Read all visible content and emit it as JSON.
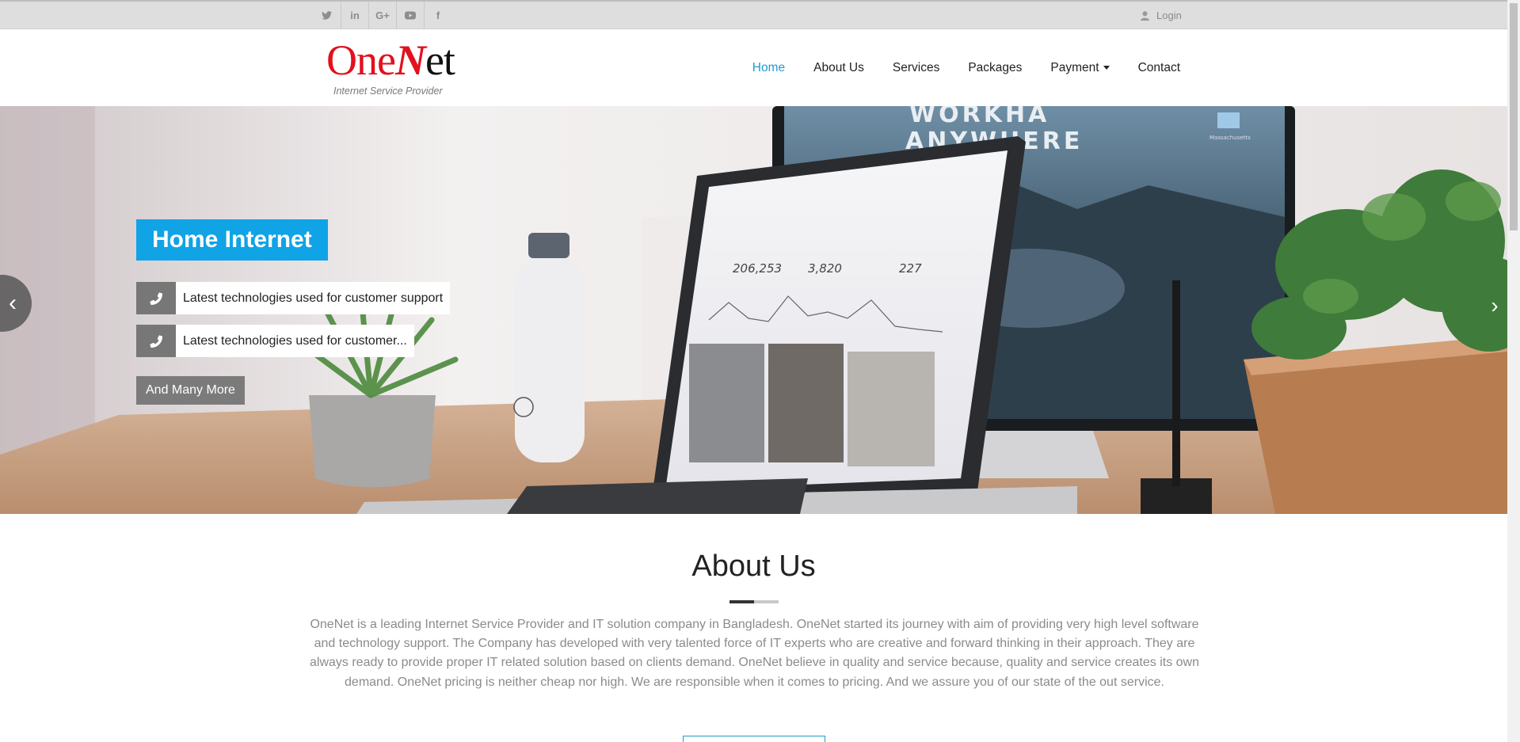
{
  "topbar": {
    "social": [
      {
        "icon": "twitter-icon",
        "glyph": "🐦"
      },
      {
        "icon": "linkedin-icon",
        "glyph": "in"
      },
      {
        "icon": "google-plus-icon",
        "glyph": "G+"
      },
      {
        "icon": "youtube-icon",
        "glyph": "▶"
      },
      {
        "icon": "facebook-icon",
        "glyph": "f"
      }
    ],
    "login_label": "Login"
  },
  "brand": {
    "part1": "One",
    "part2": "N",
    "part3": "et",
    "tagline": "Internet Service Provider",
    "colors": {
      "red": "#e3101e",
      "dark": "#111111"
    }
  },
  "nav": {
    "items": [
      "Home",
      "About Us",
      "Services",
      "Packages",
      "Payment",
      "Contact"
    ],
    "active": "Home",
    "accent": "#1e9bd6"
  },
  "hero": {
    "title": "Home Internet",
    "features": [
      "Latest technologies used for customer support",
      "Latest technologies used for customer..."
    ],
    "button": "And Many More",
    "prev": "‹",
    "next": "›",
    "title_bg": "#10a3e6",
    "screen_text": {
      "headline1": "WORKHA",
      "headline2": "ANYWHERE",
      "stat1": "206,253",
      "stat2": "3,820",
      "stat3": "227",
      "folder_label": "Massachusetts"
    }
  },
  "about": {
    "title": "About Us",
    "text": "OneNet is a leading Internet Service Provider and IT solution company in Bangladesh. OneNet started its journey with aim of providing very high level software and technology support. The Company has developed with very talented force of IT experts who are creative and forward thinking in their approach. They are always ready to provide proper IT related solution based on clients demand. OneNet believe in quality and service because, quality and service creates its own demand. OneNet pricing is neither cheap nor high. We are responsible when it comes to pricing. And we assure you of our state of the out service."
  }
}
